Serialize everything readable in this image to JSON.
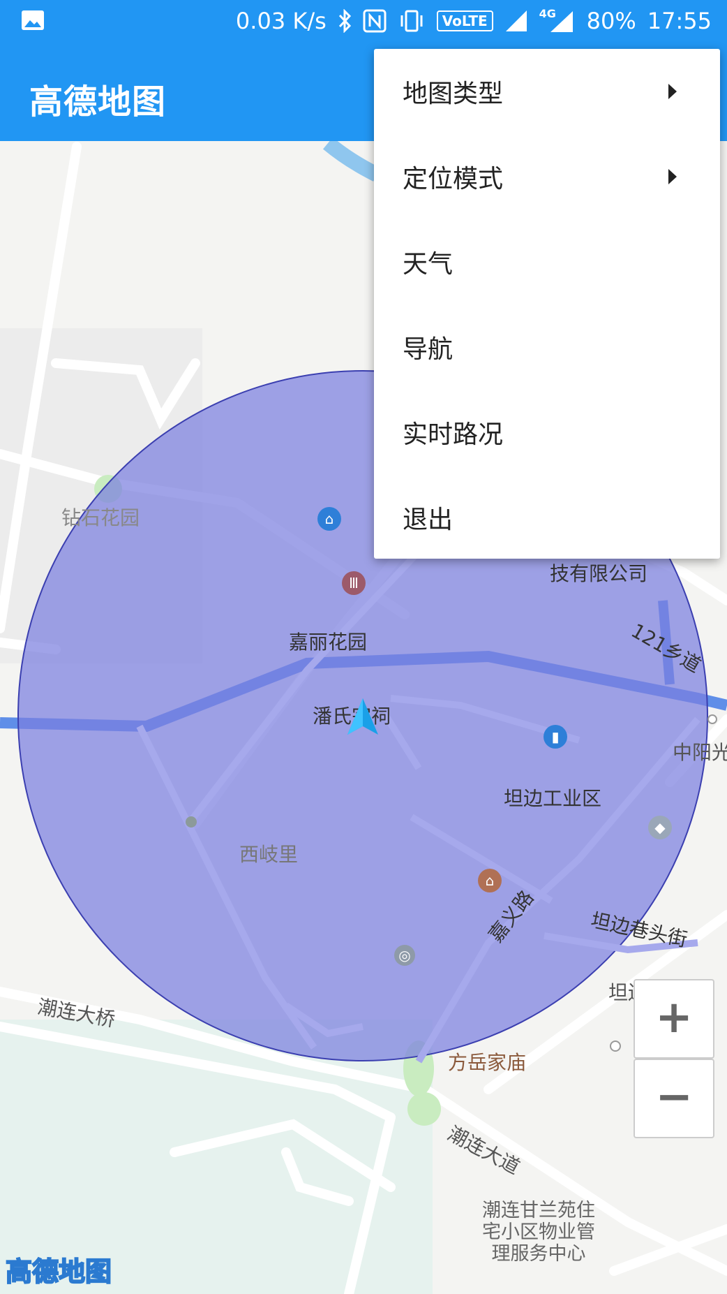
{
  "status_bar": {
    "speed": "0.03 K/s",
    "volte": "VoLTE",
    "network": "4G",
    "battery": "80%",
    "time": "17:55",
    "icons": [
      "image-icon",
      "bluetooth-icon",
      "nfc-icon",
      "vibrate-icon",
      "volte-icon",
      "signal-icon",
      "signal-4g-icon"
    ]
  },
  "app_bar": {
    "title": "高德地图"
  },
  "menu": {
    "items": [
      {
        "label": "地图类型",
        "has_submenu": true
      },
      {
        "label": "定位模式",
        "has_submenu": true
      },
      {
        "label": "天气",
        "has_submenu": false
      },
      {
        "label": "导航",
        "has_submenu": false
      },
      {
        "label": "实时路况",
        "has_submenu": false
      },
      {
        "label": "退出",
        "has_submenu": false
      }
    ]
  },
  "map": {
    "labels": {
      "zuanshi": "钻石花园",
      "company": "技有限公司",
      "road121": "121乡道",
      "jiali": "嘉丽花园",
      "panshi": "潘氏宗祠",
      "zhongyang": "中阳光",
      "tanbian_industry": "坦边工业区",
      "xiqili": "西岐里",
      "jiayilu": "嘉义路",
      "tanbian_street": "坦边巷头街",
      "kindergarten": "坦边幼儿园",
      "chaolian_bridge": "潮连大桥",
      "fangyue": "方岳家庙",
      "chaolian_avenue": "潮连大道",
      "property_center": "潮连甘兰苑住宅小区物业管理服务中心"
    },
    "logo": "高德地图",
    "zoom_in": "+",
    "zoom_out": "−",
    "colors": {
      "accuracy_circle": "#7b7fdf",
      "river": "#8fc6ee",
      "park": "#c9ecc0",
      "primary": "#2196F3"
    }
  }
}
